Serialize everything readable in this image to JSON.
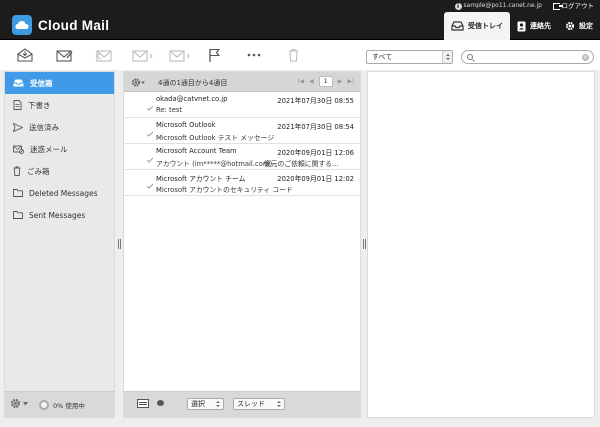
{
  "topbar": {
    "user_email": "sample@po11.canet.ne.jp",
    "logout_label": "ログアウト"
  },
  "header": {
    "app_title": "Cloud Mail",
    "nav": [
      {
        "label": "受信トレイ",
        "icon": "inbox-icon",
        "active": true
      },
      {
        "label": "連絡先",
        "icon": "contacts-icon",
        "active": false
      },
      {
        "label": "設定",
        "icon": "gear-icon",
        "active": false
      }
    ]
  },
  "toolbar": {
    "buttons": [
      "receive",
      "compose",
      "reply",
      "reply-all",
      "forward",
      "flag",
      "more",
      "delete"
    ],
    "folder_filter": "すべて",
    "search_value": "",
    "search_placeholder": ""
  },
  "sidebar": {
    "folders": [
      {
        "label": "受信箱",
        "icon": "inbox-icon",
        "active": true
      },
      {
        "label": "下書き",
        "icon": "draft-icon",
        "active": false
      },
      {
        "label": "送信済み",
        "icon": "sent-icon",
        "active": false
      },
      {
        "label": "迷惑メール",
        "icon": "spam-icon",
        "active": false
      },
      {
        "label": "ごみ箱",
        "icon": "trash-icon",
        "active": false
      },
      {
        "label": "Deleted Messages",
        "icon": "folder-icon",
        "active": false
      },
      {
        "label": "Sent Messages",
        "icon": "folder-icon",
        "active": false
      }
    ],
    "quota": "0% 使用中"
  },
  "message_list": {
    "range": "4通の1通目から4通目",
    "page": "1",
    "messages": [
      {
        "from": "okada@catvnet.co.jp",
        "date": "2021年07月30日 08:55",
        "subject": "Re: test",
        "preview": ""
      },
      {
        "from": "Microsoft Outlook",
        "date": "2021年07月30日 08:54",
        "subject": "Microsoft Outlook テスト メッセージ",
        "preview": ""
      },
      {
        "from": "Microsoft Account Team",
        "date": "2020年09月01日 12:06",
        "subject": "アカウント (im*****@hotmail.com)",
        "preview": "復元のご依頼に関する..."
      },
      {
        "from": "Microsoft アカウント チーム",
        "date": "2020年09月01日 12:02",
        "subject": "Microsoft アカウントのセキュリティ コード",
        "preview": ""
      }
    ],
    "footer": {
      "select_label": "選択",
      "thread_label": "スレッド"
    }
  },
  "colors": {
    "header_bg": "#1c1c1c",
    "accent": "#3f9be8",
    "pane_bg": "#e9e9e9"
  }
}
